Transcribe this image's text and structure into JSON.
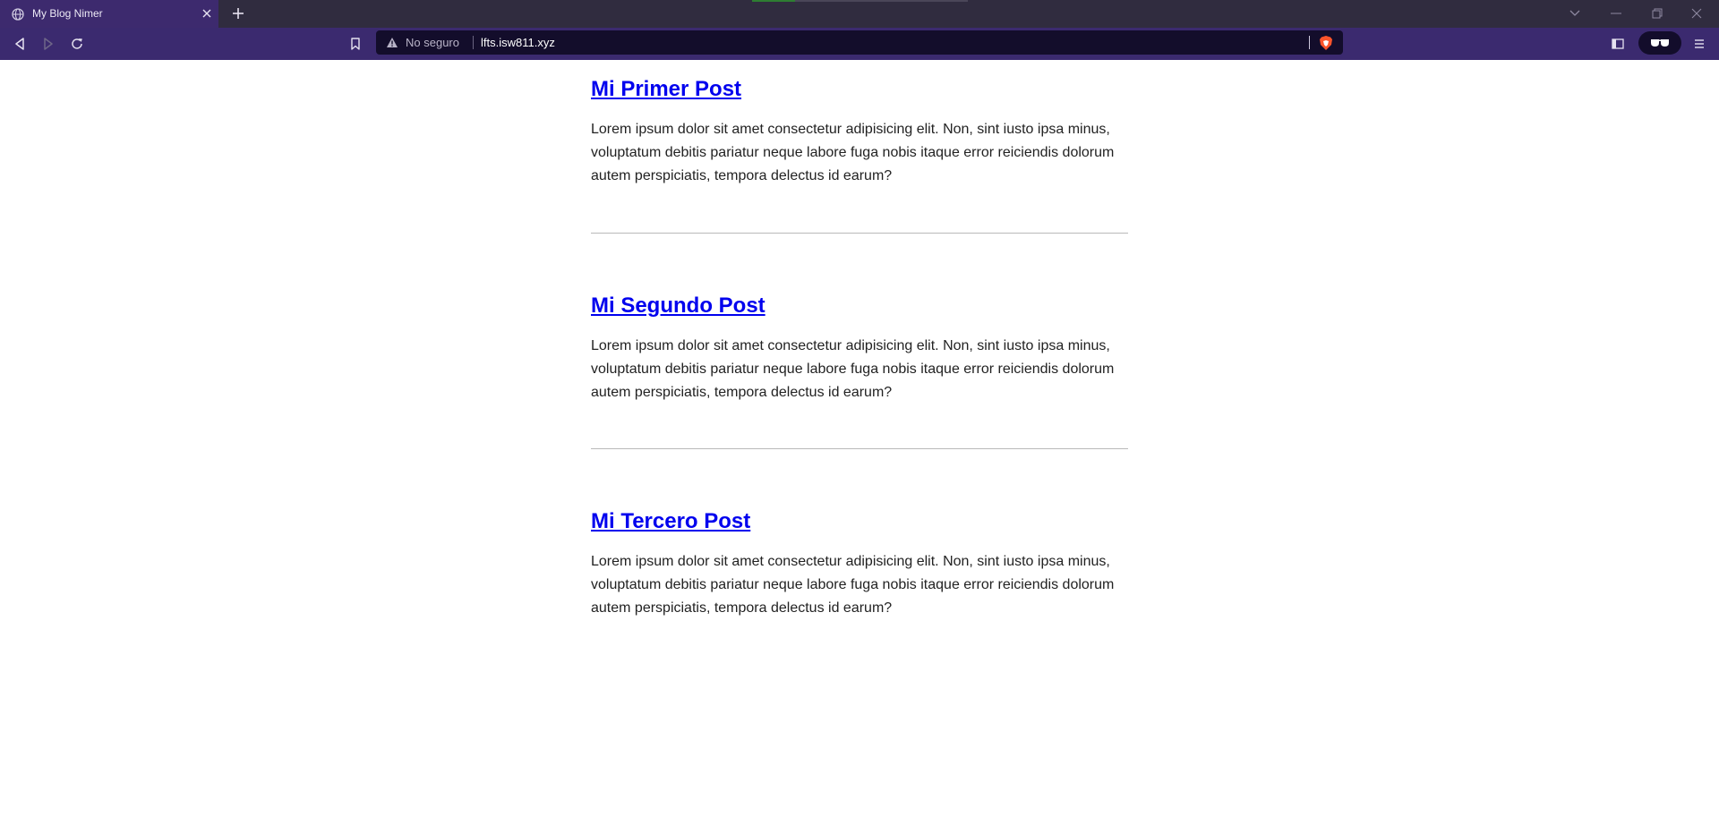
{
  "browser": {
    "tab": {
      "title": "My Blog Nimer",
      "favicon_icon": "globe-icon"
    },
    "omnibox": {
      "security_label": "No seguro",
      "url": "lfts.isw811.xyz"
    },
    "colors": {
      "tabstrip": "#302c3f",
      "toolbar": "#3b2a6f",
      "omnibox": "#130d2b",
      "brave_shield": "#fb542b"
    }
  },
  "posts": [
    {
      "title": "Mi Primer Post",
      "excerpt": "Lorem ipsum dolor sit amet consectetur adipisicing elit. Non, sint iusto ipsa minus, voluptatum debitis pariatur neque labore fuga nobis itaque error reiciendis dolorum autem perspiciatis, tempora delectus id earum?"
    },
    {
      "title": "Mi Segundo Post",
      "excerpt": "Lorem ipsum dolor sit amet consectetur adipisicing elit. Non, sint iusto ipsa minus, voluptatum debitis pariatur neque labore fuga nobis itaque error reiciendis dolorum autem perspiciatis, tempora delectus id earum?"
    },
    {
      "title": "Mi Tercero Post",
      "excerpt": "Lorem ipsum dolor sit amet consectetur adipisicing elit. Non, sint iusto ipsa minus, voluptatum debitis pariatur neque labore fuga nobis itaque error reiciendis dolorum autem perspiciatis, tempora delectus id earum?"
    }
  ],
  "colors": {
    "link": "#0000ee",
    "body_text": "#222222",
    "divider": "#b9b9b9"
  }
}
